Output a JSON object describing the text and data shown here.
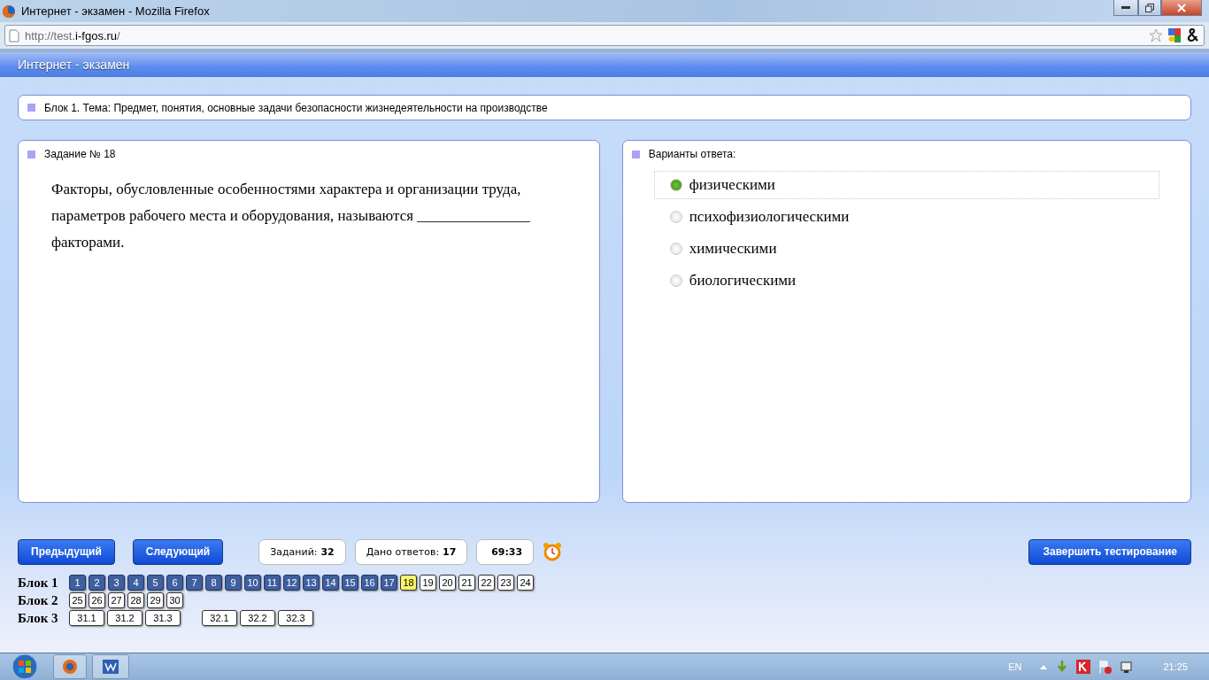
{
  "window": {
    "title": "Интернет - экзамен - Mozilla Firefox"
  },
  "address_bar": {
    "host_prefix": "http://test.",
    "domain": "i-fgos.ru",
    "path": "/"
  },
  "app_header": {
    "title": "Интернет - экзамен"
  },
  "block_panel": {
    "text": "Блок 1. Тема: Предмет, понятия, основные задачи безопасности жизнедеятельности на производстве"
  },
  "question_panel": {
    "title": "Задание № 18",
    "text": "Факторы, обусловленные особенностями характера и организации труда, параметров рабочего места и оборудования, называются _______________ факторами."
  },
  "answers_panel": {
    "title": "Варианты ответа:",
    "options": [
      {
        "label": "физическими",
        "selected": true
      },
      {
        "label": "психофизиологическими",
        "selected": false
      },
      {
        "label": "химическими",
        "selected": false
      },
      {
        "label": "биологическими",
        "selected": false
      }
    ]
  },
  "footer": {
    "prev_button": "Предыдущий",
    "next_button": "Следующий",
    "stats": [
      {
        "label": "Заданий:",
        "value": "32"
      },
      {
        "label": "Дано ответов:",
        "value": "17"
      },
      {
        "value": "69:33"
      }
    ],
    "finish_button": "Завершить тестирование"
  },
  "navigation": [
    {
      "label": "Блок 1",
      "groups": [
        {
          "items": [
            {
              "label": "1",
              "answered": true,
              "selected": false
            },
            {
              "label": "2",
              "answered": true,
              "selected": false
            },
            {
              "label": "3",
              "answered": true,
              "selected": false
            },
            {
              "label": "4",
              "answered": true,
              "selected": false
            },
            {
              "label": "5",
              "answered": true,
              "selected": false
            },
            {
              "label": "6",
              "answered": true,
              "selected": false
            },
            {
              "label": "7",
              "answered": true,
              "selected": false
            },
            {
              "label": "8",
              "answered": true,
              "selected": false
            },
            {
              "label": "9",
              "answered": true,
              "selected": false
            },
            {
              "label": "10",
              "answered": true,
              "selected": false
            },
            {
              "label": "11",
              "answered": true,
              "selected": false
            },
            {
              "label": "12",
              "answered": true,
              "selected": false
            },
            {
              "label": "13",
              "answered": true,
              "selected": false
            },
            {
              "label": "14",
              "answered": true,
              "selected": false
            },
            {
              "label": "15",
              "answered": true,
              "selected": false
            },
            {
              "label": "16",
              "answered": true,
              "selected": false
            },
            {
              "label": "17",
              "answered": true,
              "selected": false
            },
            {
              "label": "18",
              "answered": false,
              "selected": true
            },
            {
              "label": "19",
              "answered": false,
              "selected": false
            },
            {
              "label": "20",
              "answered": false,
              "selected": false
            },
            {
              "label": "21",
              "answered": false,
              "selected": false
            },
            {
              "label": "22",
              "answered": false,
              "selected": false
            },
            {
              "label": "23",
              "answered": false,
              "selected": false
            },
            {
              "label": "24",
              "answered": false,
              "selected": false
            }
          ]
        }
      ]
    },
    {
      "label": "Блок 2",
      "groups": [
        {
          "items": [
            {
              "label": "25",
              "answered": false,
              "selected": false
            },
            {
              "label": "26",
              "answered": false,
              "selected": false
            },
            {
              "label": "27",
              "answered": false,
              "selected": false
            },
            {
              "label": "28",
              "answered": false,
              "selected": false
            },
            {
              "label": "29",
              "answered": false,
              "selected": false
            },
            {
              "label": "30",
              "answered": false,
              "selected": false
            }
          ]
        }
      ]
    },
    {
      "label": "Блок 3",
      "groups": [
        {
          "items": [
            {
              "label": "31.1",
              "answered": false,
              "selected": false
            },
            {
              "label": "31.2",
              "answered": false,
              "selected": false
            },
            {
              "label": "31.3",
              "answered": false,
              "selected": false
            }
          ]
        },
        {
          "items": [
            {
              "label": "32.1",
              "answered": false,
              "selected": false
            },
            {
              "label": "32.2",
              "answered": false,
              "selected": false
            },
            {
              "label": "32.3",
              "answered": false,
              "selected": false
            }
          ]
        }
      ]
    }
  ],
  "taskbar": {
    "language": "EN",
    "clock": "21:25"
  }
}
